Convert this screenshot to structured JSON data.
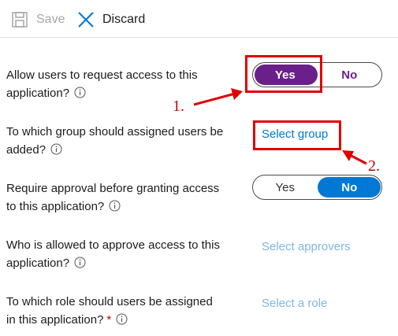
{
  "toolbar": {
    "save_label": "Save",
    "discard_label": "Discard"
  },
  "settings": [
    {
      "label_line1": "Allow users to request access to this",
      "label_line2": "application?",
      "control": "toggle",
      "yes_label": "Yes",
      "no_label": "No",
      "selected": "Yes"
    },
    {
      "label_line1": "To which group should assigned users be",
      "label_line2": "added?",
      "control": "link",
      "link_label": "Select group"
    },
    {
      "label_line1": "Require approval before granting access",
      "label_line2": "to this application?",
      "control": "toggle",
      "yes_label": "Yes",
      "no_label": "No",
      "selected": "No"
    },
    {
      "label_line1": "Who is allowed to approve access to this",
      "label_line2": "application?",
      "control": "link",
      "link_label": "Select approvers"
    },
    {
      "label_line1": "To which role should users be assigned",
      "label_line2": "in this application?",
      "required_mark": "*",
      "control": "link",
      "link_label": "Select a role"
    }
  ],
  "annotations": {
    "step1": "1.",
    "step2": "2."
  },
  "colors": {
    "toggle_selected_yes": "#6b1f8a",
    "toggle_selected_no": "#0078d4",
    "link": "#0078d4",
    "link_disabled": "#7fb6e6",
    "annotation": "#e00000"
  },
  "icons": [
    "save-icon",
    "discard-icon",
    "info-icon"
  ]
}
